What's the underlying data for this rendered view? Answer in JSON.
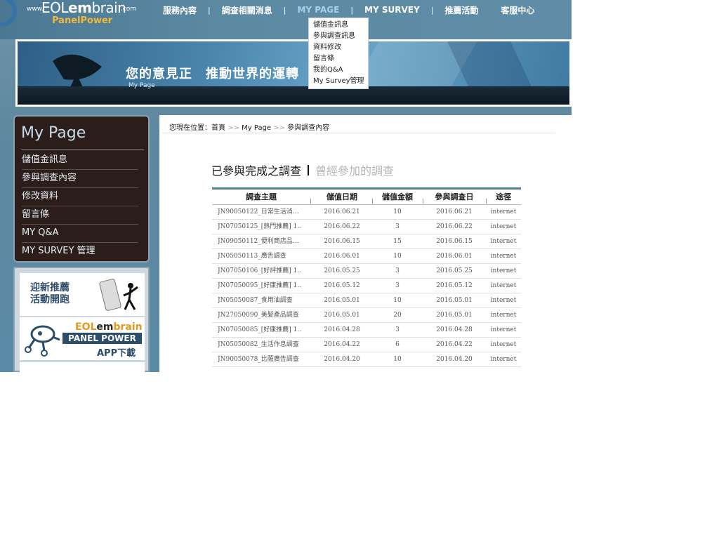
{
  "logo": {
    "www": "www.",
    "brand_prefix": "EOL",
    "brand_em": "em",
    "brand_suffix": "brain",
    "com": ".com",
    "sub": "PanelPower"
  },
  "nav": {
    "items": [
      "服務內容",
      "調查相關消息",
      "MY PAGE",
      "MY SURVEY",
      "推薦活動",
      "客服中心"
    ],
    "separator": "|"
  },
  "dropdown": {
    "items": [
      "儲值金訊息",
      "參與調查訊息",
      "資料修改",
      "留言條",
      "我的Q&A",
      "My Survey管理"
    ]
  },
  "banner": {
    "slogan": "您的意見正　推動世界的運轉",
    "subtitle": "My Page"
  },
  "sidebar": {
    "title": "My Page",
    "items": [
      "儲值金訊息",
      "參與調查內容",
      "修改資料",
      "留言條",
      "MY Q&A",
      "MY SURVEY 管理"
    ]
  },
  "promos": {
    "referral": {
      "line1": "迎新推薦",
      "line2": "活動開跑"
    },
    "app": {
      "brand_prefix": "EOL",
      "brand_em": "em",
      "brand_suffix": "brain",
      "panel": "PANEL POWER",
      "download": "APP下載"
    }
  },
  "breadcrumb": {
    "prefix": "您現在位置：",
    "home": "首頁",
    "sep": ">>",
    "mypage": "My Page",
    "current": "參與調查內容"
  },
  "heading": {
    "active": "已參與完成之調查",
    "inactive": "曾經參加的調查"
  },
  "table": {
    "headers": [
      "調查主題",
      "儲值日期",
      "儲值金額",
      "參與調查日",
      "途徑"
    ],
    "rows": [
      [
        "JN90050122_日常生活消…",
        "2016.06.21",
        "10",
        "2016.06.21",
        "internet"
      ],
      [
        "JN07050125_[熱門推薦] 1…",
        "2016.06.22",
        "3",
        "2016.06.22",
        "internet"
      ],
      [
        "JN09050112_便利商店品…",
        "2016.06.15",
        "15",
        "2016.06.15",
        "internet"
      ],
      [
        "JN05050113_廣告調查",
        "2016.06.01",
        "10",
        "2016.06.01",
        "internet"
      ],
      [
        "JN07050106_[好評推薦] 1…",
        "2016.05.25",
        "3",
        "2016.05.25",
        "internet"
      ],
      [
        "JN07050095_[好康推薦] 1…",
        "2016.05.12",
        "3",
        "2016.05.12",
        "internet"
      ],
      [
        "JN05050087_食用油調查",
        "2016.05.01",
        "10",
        "2016.05.01",
        "internet"
      ],
      [
        "JN27050090_美髮產品調查",
        "2016.05.01",
        "20",
        "2016.05.01",
        "internet"
      ],
      [
        "JN07050085_[好康推薦] 1…",
        "2016.04.28",
        "3",
        "2016.04.28",
        "internet"
      ],
      [
        "JN05050082_生活作息調查",
        "2016.04.22",
        "6",
        "2016.04.22",
        "internet"
      ],
      [
        "JN90050078_比薩廣告調查",
        "2016.04.20",
        "10",
        "2016.04.20",
        "internet"
      ]
    ]
  }
}
